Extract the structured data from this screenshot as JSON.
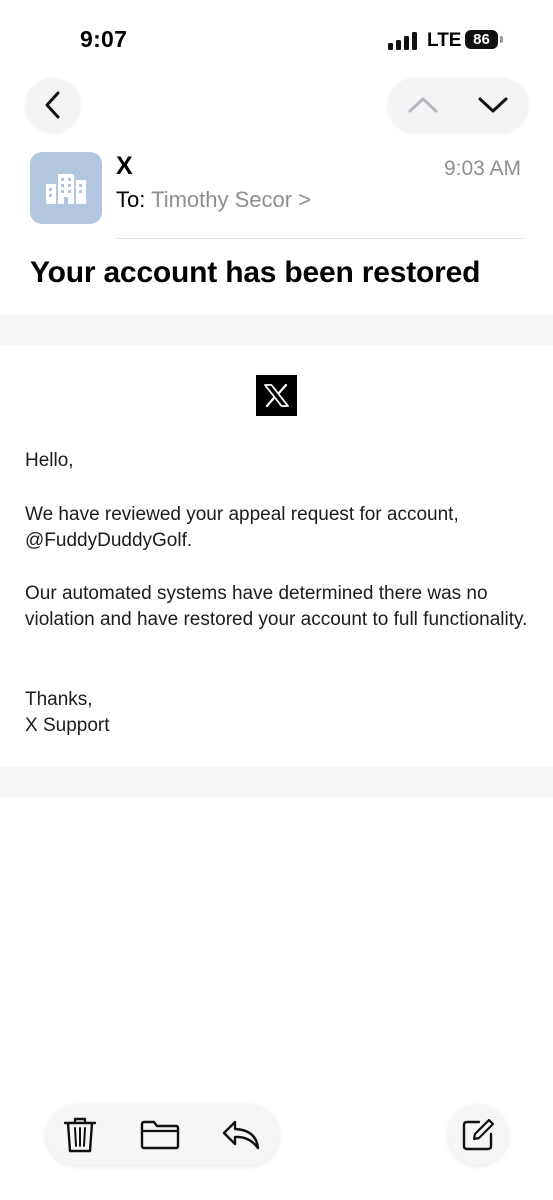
{
  "status_bar": {
    "time": "9:07",
    "network": "LTE",
    "battery": "86"
  },
  "message": {
    "sender": "X",
    "to_label": "To:",
    "recipient": "Timothy Secor",
    "recipient_chevron": ">",
    "time": "9:03 AM",
    "subject": "Your account has been restored"
  },
  "email_body": {
    "greeting": "Hello,",
    "paragraph1": "We have reviewed your appeal request for account, @FuddyDuddyGolf.",
    "paragraph2": "Our automated systems have determined there was no violation and have restored your account to full functionality.",
    "signoff_line1": "Thanks,",
    "signoff_line2": "X Support"
  },
  "icons": {
    "back": "chevron-left-icon",
    "previous": "chevron-up-icon",
    "next": "chevron-down-icon",
    "avatar": "building-icon",
    "logo": "x-logo",
    "trash": "trash-icon",
    "folder": "folder-icon",
    "reply": "reply-icon",
    "compose": "compose-icon"
  },
  "colors": {
    "avatar_bg": "#b3c6e0",
    "secondary_text": "#8e8e93",
    "band": "#f6f7f9"
  }
}
